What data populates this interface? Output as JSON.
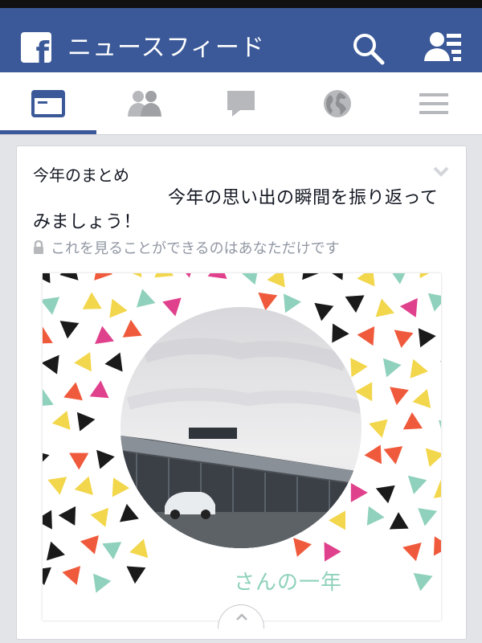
{
  "app": {
    "title": "ニュースフィード",
    "logo_letter": "f",
    "brand_color": "#3b5998"
  },
  "header": {
    "search_icon": "search-icon",
    "friend_requests_icon": "friend-requests-icon"
  },
  "tabs": [
    {
      "name": "news-feed",
      "icon": "news-feed-icon",
      "active": true
    },
    {
      "name": "friends",
      "icon": "friends-icon",
      "active": false
    },
    {
      "name": "messages",
      "icon": "chat-bubble-icon",
      "active": false
    },
    {
      "name": "notifications",
      "icon": "globe-icon",
      "active": false
    },
    {
      "name": "more",
      "icon": "menu-icon",
      "active": false
    }
  ],
  "card": {
    "title": "今年のまとめ",
    "message": "今年の思い出の瞬間を振り返ってみましょう！",
    "privacy": "これを見ることができるのはあなただけです",
    "year_label": "さんの一年",
    "confetti_colors": [
      "#1a1a1a",
      "#f05a3c",
      "#f2d64b",
      "#8fd1bc",
      "#e0418c"
    ]
  }
}
